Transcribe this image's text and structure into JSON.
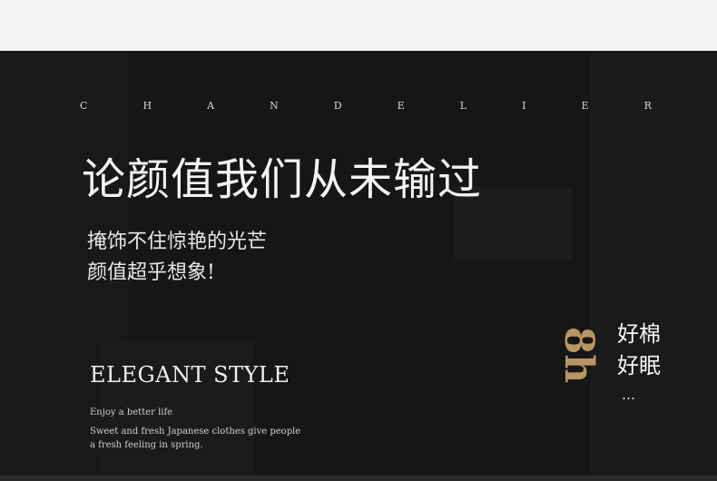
{
  "top_strip": {
    "color": "#f4f4f4"
  },
  "banner": {
    "brand_letters": [
      "C",
      "H",
      "A",
      "N",
      "D",
      "E",
      "L",
      "I",
      "E",
      "R"
    ],
    "headline": "论颜值我们从未输过",
    "subline_1": "掩饰不住惊艳的光芒",
    "subline_2": "颜值超乎想象!",
    "style_title": "ELEGANT STYLE",
    "enjoy": "Enjoy a better life",
    "desc_1": "Sweet and fresh Japanese clothes give people",
    "desc_2": "a fresh feeling in spring.",
    "badge_value": "8h",
    "badge_line_1": "好棉",
    "badge_line_2": "好眠",
    "badge_dots": "…"
  }
}
